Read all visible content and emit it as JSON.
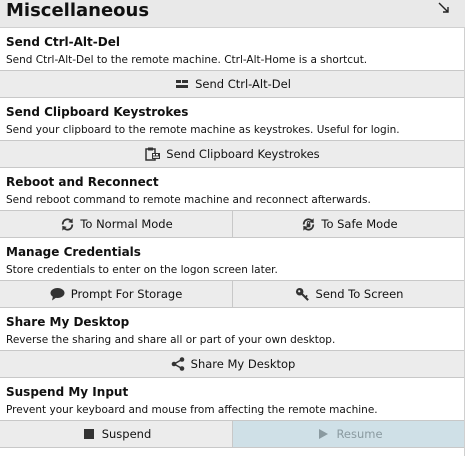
{
  "header": {
    "title": "Miscellaneous"
  },
  "sections": [
    {
      "title": "Send Ctrl-Alt-Del",
      "desc": "Send Ctrl-Alt-Del to the remote machine. Ctrl-Alt-Home is a shortcut.",
      "buttons": [
        {
          "label": "Send Ctrl-Alt-Del",
          "icon": "keyboard-icon"
        }
      ]
    },
    {
      "title": "Send Clipboard Keystrokes",
      "desc": "Send your clipboard to the remote machine as keystrokes. Useful for login.",
      "buttons": [
        {
          "label": "Send Clipboard Keystrokes",
          "icon": "clipboard-icon"
        }
      ]
    },
    {
      "title": "Reboot and Reconnect",
      "desc": "Send reboot command to remote machine and reconnect afterwards.",
      "buttons": [
        {
          "label": "To Normal Mode",
          "icon": "refresh-icon"
        },
        {
          "label": "To Safe Mode",
          "icon": "refresh-lock-icon"
        }
      ]
    },
    {
      "title": "Manage Credentials",
      "desc": "Store credentials to enter on the logon screen later.",
      "buttons": [
        {
          "label": "Prompt For Storage",
          "icon": "speech-bubble-icon"
        },
        {
          "label": "Send To Screen",
          "icon": "key-icon"
        }
      ]
    },
    {
      "title": "Share My Desktop",
      "desc": "Reverse the sharing and share all or part of your own desktop.",
      "buttons": [
        {
          "label": "Share My Desktop",
          "icon": "share-icon"
        }
      ]
    },
    {
      "title": "Suspend My Input",
      "desc": "Prevent your keyboard and mouse from affecting the remote machine.",
      "buttons": [
        {
          "label": "Suspend",
          "icon": "stop-icon"
        },
        {
          "label": "Resume",
          "icon": "play-icon",
          "disabled": true
        }
      ]
    }
  ]
}
